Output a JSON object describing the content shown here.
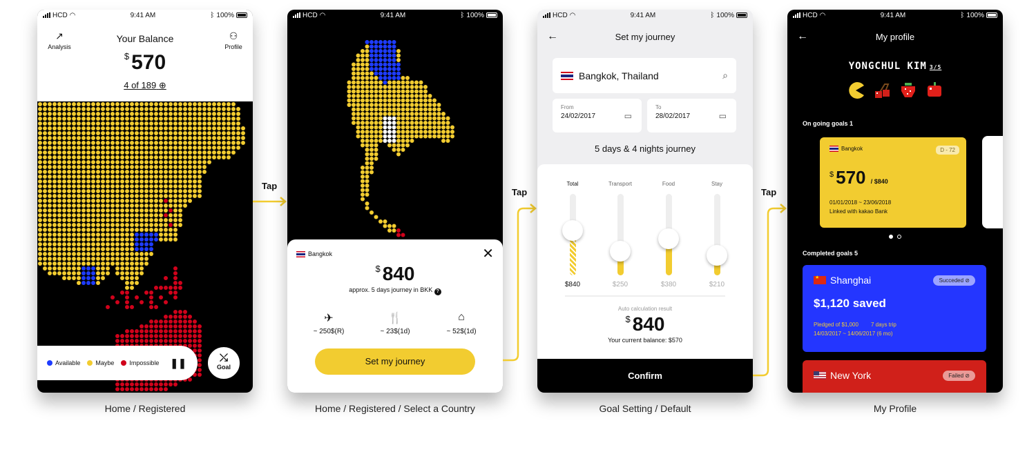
{
  "status_bar": {
    "carrier": "HCD",
    "time": "9:41 AM",
    "battery": "100%"
  },
  "colors": {
    "accent_yellow": "#f2cc30",
    "available_blue": "#1e3cff",
    "impossible_red": "#d0021b",
    "dark": "#000000"
  },
  "connectors": {
    "tap_label": "Tap"
  },
  "screen1": {
    "caption": "Home / Registered",
    "analysis_label": "Analysis",
    "profile_label": "Profile",
    "balance_title": "Your Balance",
    "currency": "$",
    "balance": "570",
    "countries": "4 of 189",
    "legend": {
      "available": "Available",
      "maybe": "Maybe",
      "impossible": "Impossible"
    },
    "goal_label": "Goal"
  },
  "screen2": {
    "caption": "Home / Registered / Select a Country",
    "country": "Bangkok",
    "currency": "$",
    "amount": "840",
    "approx": "approx. 5 days journey in BKK",
    "costs": [
      {
        "icon": "airplane-icon",
        "label": "~ 250$(R)"
      },
      {
        "icon": "fork-knife-icon",
        "label": "~ 23$(1d)"
      },
      {
        "icon": "house-icon",
        "label": "~ 52$(1d)"
      }
    ],
    "cta": "Set my journey"
  },
  "screen3": {
    "caption": "Goal Setting / Default",
    "title": "Set my journey",
    "search_value": "Bangkok, Thailand",
    "from_label": "From",
    "from_date": "24/02/2017",
    "to_label": "To",
    "to_date": "28/02/2017",
    "duration": "5 days & 4 nights journey",
    "sliders": [
      {
        "label": "Total",
        "value": "$840",
        "level": 0.55,
        "active": true
      },
      {
        "label": "Transport",
        "value": "$250",
        "level": 0.3,
        "active": false
      },
      {
        "label": "Food",
        "value": "$380",
        "level": 0.45,
        "active": false
      },
      {
        "label": "Stay",
        "value": "$210",
        "level": 0.25,
        "active": false
      }
    ],
    "auto_calc_label": "Auto calculation result",
    "currency": "$",
    "amount": "840",
    "current_balance": "Your current balance: $570",
    "confirm": "Confirm"
  },
  "screen4": {
    "caption": "My Profile",
    "title": "My profile",
    "username": "YONGCHUL KIM",
    "level": "3/5",
    "badges": [
      "pacman-icon",
      "cherry-icon",
      "strawberry-icon",
      "apple-icon"
    ],
    "ongoing_title": "On going goals 1",
    "ongoing": {
      "city": "Bangkok",
      "dday": "D - 72",
      "currency": "$",
      "amount": "570",
      "target": "/ $840",
      "dates": "01/01/2018 ~ 23/06/2018",
      "bank": "Linked with kakao Bank"
    },
    "completed_title": "Completed goals 5",
    "completed": [
      {
        "city": "Shanghai",
        "status": "Succeded",
        "saved": "$1,120 saved",
        "pledged": "Pledged of $1,000",
        "trip": "7 days trip",
        "dates": "14/03/2017 ~ 14/06/2017 (6 mo)",
        "color": "#2436ff"
      },
      {
        "city": "New York",
        "status": "Failed",
        "color": "#d0201a"
      }
    ]
  }
}
